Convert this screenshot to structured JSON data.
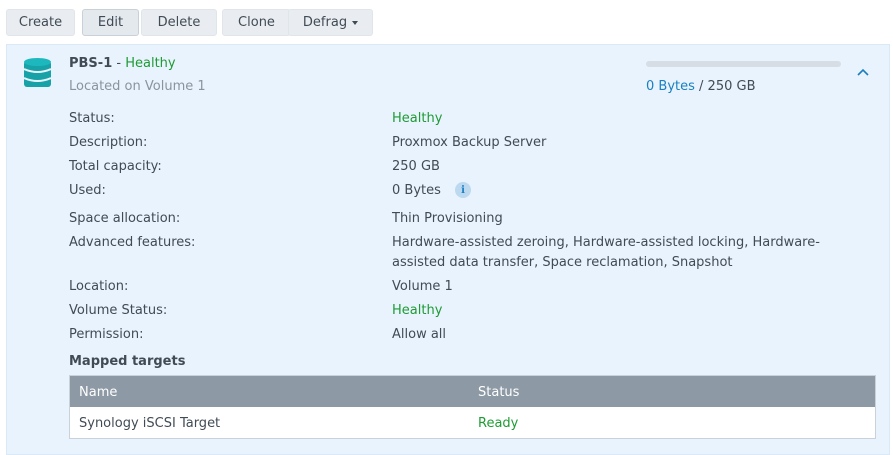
{
  "toolbar": {
    "create_label": "Create",
    "edit_label": "Edit",
    "delete_label": "Delete",
    "clone_label": "Clone",
    "defrag_label": "Defrag"
  },
  "lun": {
    "icon": "database-icon",
    "name": "PBS-1",
    "separator": " - ",
    "status": "Healthy",
    "location_text": "Located on Volume 1",
    "usage_used": "0 Bytes",
    "usage_separator": " / ",
    "usage_total": "250 GB",
    "usage_fraction": 0,
    "collapse_icon": "chevron-up-icon"
  },
  "details": [
    {
      "label": "Status:",
      "value": "Healthy"
    },
    {
      "label": "Description:",
      "value": "Proxmox Backup Server"
    },
    {
      "label": "Total capacity:",
      "value": "250 GB"
    },
    {
      "label": "Used:",
      "value": "0 Bytes"
    },
    {
      "label": "Space allocation:",
      "value": "Thin Provisioning"
    },
    {
      "label": "Advanced features:",
      "value": "Hardware-assisted zeroing, Hardware-assisted locking, Hardware-assisted data transfer, Space reclamation, Snapshot"
    },
    {
      "label": "Location:",
      "value": "Volume 1"
    },
    {
      "label": "Volume Status:",
      "value": "Healthy"
    },
    {
      "label": "Permission:",
      "value": "Allow all"
    }
  ],
  "info_icon": "info-icon",
  "mapped_targets": {
    "title": "Mapped targets",
    "columns": [
      "Name",
      "Status"
    ],
    "rows": [
      {
        "name": "Synology iSCSI Target",
        "status": "Ready"
      }
    ]
  },
  "colors": {
    "healthy": "#1f9b34",
    "accent": "#1a7fc1",
    "panel_bg": "#e8f3fd",
    "table_header": "#8d99a4"
  }
}
